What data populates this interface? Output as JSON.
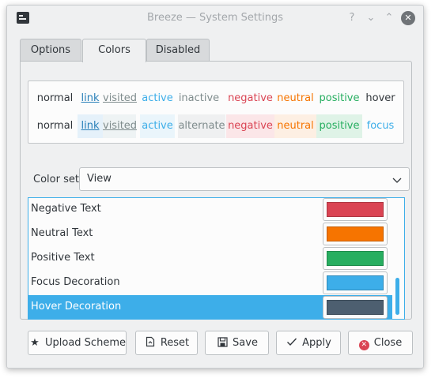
{
  "window": {
    "title": "Breeze — System Settings",
    "buttons": {
      "help": "?",
      "minimize": "⌄",
      "maximize": "⌃",
      "close": "✕"
    }
  },
  "tabs": [
    {
      "label": "Options"
    },
    {
      "label": "Colors",
      "active": true
    },
    {
      "label": "Disabled"
    }
  ],
  "preview": {
    "row1": [
      "normal",
      "link",
      "visited",
      "active",
      "inactive",
      "negative",
      "neutral",
      "positive",
      "hover"
    ],
    "row2": [
      "normal",
      "link",
      "visited",
      "active",
      "alternate",
      "negative",
      "neutral",
      "positive",
      "focus"
    ]
  },
  "color_set": {
    "label": "Color set:",
    "value": "View"
  },
  "color_list": [
    {
      "name": "Negative Text",
      "color": "#da4453"
    },
    {
      "name": "Neutral Text",
      "color": "#f67400"
    },
    {
      "name": "Positive Text",
      "color": "#27ae60"
    },
    {
      "name": "Focus Decoration",
      "color": "#3daee9"
    },
    {
      "name": "Hover Decoration",
      "color": "#4d5f70",
      "selected": true
    }
  ],
  "buttons": {
    "upload": "Upload Scheme",
    "reset": "Reset",
    "save": "Save",
    "apply": "Apply",
    "close": "Close"
  },
  "colors": {
    "accent": "#3daee9",
    "negative": "#da4453",
    "neutral": "#f67400",
    "positive": "#27ae60",
    "link": "#2980b9",
    "visited": "#7f8c8d",
    "inactive": "#7f8c8d"
  }
}
